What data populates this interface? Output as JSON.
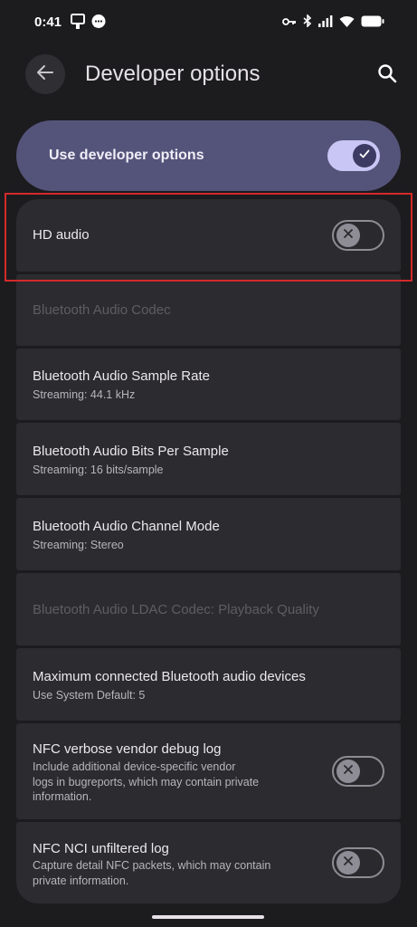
{
  "status_bar": {
    "time": "0:41",
    "left_icons": [
      "cast-icon",
      "chat-icon"
    ],
    "right_icons": [
      "key-icon",
      "bluetooth-icon",
      "signal-icon",
      "wifi-icon",
      "battery-icon"
    ]
  },
  "app_bar": {
    "title": "Developer options",
    "back_icon": "arrow-back-icon",
    "search_icon": "search-icon"
  },
  "master": {
    "label": "Use developer options",
    "enabled": true
  },
  "settings": [
    {
      "title": "HD audio",
      "toggle": "off",
      "highlighted": true
    },
    {
      "title": "Bluetooth Audio Codec",
      "disabled": true
    },
    {
      "title": "Bluetooth Audio Sample Rate",
      "subtitle": "Streaming: 44.1 kHz"
    },
    {
      "title": "Bluetooth Audio Bits Per Sample",
      "subtitle": "Streaming: 16 bits/sample"
    },
    {
      "title": "Bluetooth Audio Channel Mode",
      "subtitle": "Streaming: Stereo"
    },
    {
      "title": "Bluetooth Audio LDAC Codec: Playback Quality",
      "disabled": true
    },
    {
      "title": "Maximum connected Bluetooth audio devices",
      "subtitle": "Use System Default: 5"
    },
    {
      "title": "NFC verbose vendor debug log",
      "subtitle": "Include additional device-specific vendor logs in bugreports, which may contain private information.",
      "subtitle_lines": [
        "Include additional device-specific vendor",
        "logs in bugreports, which may contain private",
        "information."
      ],
      "toggle": "off"
    },
    {
      "title": "NFC NCI unfiltered log",
      "subtitle": "Capture detail NFC packets, which may contain private information.",
      "subtitle_lines": [
        "Capture detail NFC packets, which may contain",
        "private information."
      ],
      "toggle": "off"
    }
  ],
  "colors": {
    "background": "#1c1c1f",
    "card": "#2b2b30",
    "master_bg": "#54547a",
    "toggle_on": "#c9c6f5",
    "highlight_border": "#d32a2a"
  }
}
